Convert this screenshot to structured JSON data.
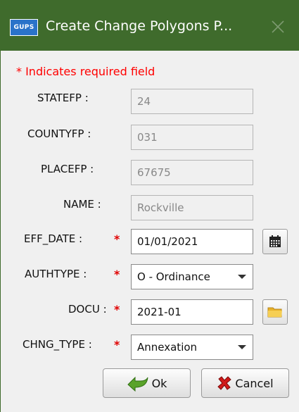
{
  "window": {
    "title": "Create Change Polygons P...",
    "app_icon_text": "GUPS"
  },
  "required_note": "* Indicates required field",
  "fields": {
    "statefp": {
      "label": "STATEFP :",
      "value": "24"
    },
    "countyfp": {
      "label": "COUNTYFP :",
      "value": "031"
    },
    "placefp": {
      "label": "PLACEFP :",
      "value": "67675"
    },
    "name": {
      "label": "NAME :",
      "value": "Rockville"
    },
    "eff_date": {
      "label": "EFF_DATE :",
      "value": "01/01/2021",
      "required": "*"
    },
    "authtype": {
      "label": "AUTHTYPE :",
      "value": "O - Ordinance",
      "required": "*"
    },
    "docu": {
      "label": "DOCU :",
      "value": "2021-01",
      "required": "*"
    },
    "chng_type": {
      "label": "CHNG_TYPE :",
      "value": "Annexation",
      "required": "*"
    }
  },
  "buttons": {
    "ok_label": "Ok",
    "cancel_label": "Cancel"
  },
  "colors": {
    "titlebar": "#3f6b2c",
    "required": "#ff0000"
  }
}
